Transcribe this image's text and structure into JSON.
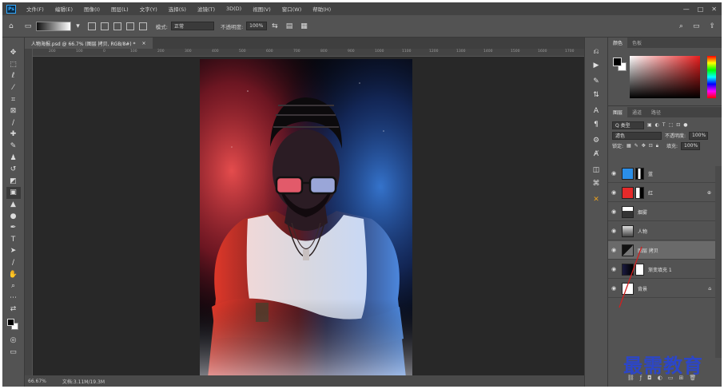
{
  "menu": {
    "logo": "Ps",
    "items": [
      "文件(F)",
      "编辑(E)",
      "图像(I)",
      "图层(L)",
      "文字(Y)",
      "选择(S)",
      "滤镜(T)",
      "3D(D)",
      "视图(V)",
      "窗口(W)",
      "帮助(H)"
    ]
  },
  "options": {
    "mode_label": "模式:",
    "mode_value": "正常",
    "opacity_label": "不透明度:",
    "opacity_value": "100%"
  },
  "document": {
    "tab_title": "人物海报.psd @ 66.7% (图层 拷贝, RGB/8#) *",
    "tab_close": "×",
    "ruler_ticks": [
      "200",
      "100",
      "0",
      "100",
      "200",
      "300",
      "400",
      "500",
      "600",
      "700",
      "800",
      "900",
      "1000",
      "1100",
      "1200",
      "1300",
      "1400",
      "1500",
      "1600",
      "1700"
    ],
    "zoom": "66.67%",
    "doc_info": "文档:3.11M/19.3M"
  },
  "color_panel": {
    "tabs": [
      "颜色",
      "色板"
    ]
  },
  "layers_panel": {
    "tabs": [
      "图层",
      "通道",
      "路径"
    ],
    "filter_label": "Q 类型",
    "blend_mode": "滤色",
    "opacity_label": "不透明度:",
    "opacity_value": "100%",
    "lock_label": "锁定:",
    "fill_label": "填充:",
    "fill_value": "100%",
    "layers": [
      {
        "name": "蓝",
        "thumb": "#2b8fe8",
        "selected": false
      },
      {
        "name": "红",
        "thumb": "#e52a2a",
        "selected": false
      },
      {
        "name": "烟雾",
        "thumb": "#cfcfcf",
        "selected": false
      },
      {
        "name": "人物",
        "thumb": "#9a9a9a",
        "selected": false
      },
      {
        "name": "图层 拷贝",
        "thumb": "#222222",
        "selected": true
      },
      {
        "name": "渐变填充 1",
        "thumb": "#1a1a40",
        "selected": false
      },
      {
        "name": "背景",
        "thumb": "#ffffff",
        "selected": false
      }
    ]
  },
  "watermark": "最需教育",
  "colors": {
    "accent_gold": "#e8a020",
    "watermark_blue": "#2c46c8",
    "ps_blue": "#31a8ff"
  }
}
